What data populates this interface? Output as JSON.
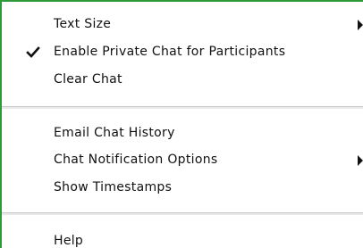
{
  "menu": {
    "items": [
      {
        "label": "Text Size",
        "checked": false,
        "submenu": true,
        "icon": "submenu-arrow-icon"
      },
      {
        "label": "Enable Private Chat for Participants",
        "checked": true,
        "submenu": false,
        "icon": "checkmark-icon"
      },
      {
        "label": "Clear Chat",
        "checked": false,
        "submenu": false
      },
      {
        "label": "Email Chat History",
        "checked": false,
        "submenu": false
      },
      {
        "label": "Chat Notification Options",
        "checked": false,
        "submenu": true,
        "icon": "submenu-arrow-icon"
      },
      {
        "label": "Show Timestamps",
        "checked": false,
        "submenu": false
      },
      {
        "label": "Help",
        "checked": false,
        "submenu": false
      }
    ]
  },
  "colors": {
    "border_accent": "#2e9a3a",
    "text": "#111111",
    "divider": "#c9c9c9"
  }
}
